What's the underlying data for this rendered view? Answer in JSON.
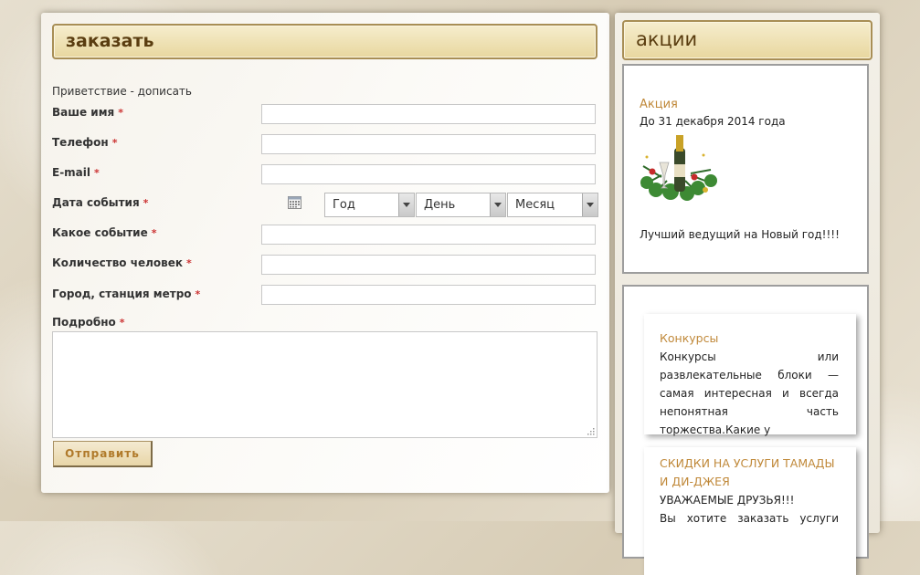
{
  "order_panel": {
    "title": "заказать",
    "greeting": "Приветствие - дописать",
    "required_mark": "*",
    "fields": {
      "name_label": "Ваше имя",
      "phone_label": "Телефон",
      "email_label": "E-mail",
      "date_label": "Дата события",
      "event_label": "Какое событие",
      "guests_label": "Количество человек",
      "city_label": "Город, станция метро",
      "details_label": "Подробно"
    },
    "date_selects": {
      "year": "Год",
      "day": "День",
      "month": "Месяц"
    },
    "submit_label": "Отправить"
  },
  "promo_panel": {
    "title": "акции",
    "promo": {
      "link": "Акция",
      "date": "До 31 декабря 2014 года",
      "text": "Лучший ведущий на Новый год!!!!",
      "image_icon": "champagne-christmas-icon"
    },
    "cards": [
      {
        "title": "Конкурсы",
        "body": "Конкурсы или развлекательные блоки — самая интересная и всегда непонятная часть торжества.Какие у"
      },
      {
        "title": "СКИДКИ НА УСЛУГИ ТАМАДЫ И ДИ-ДЖЕЯ",
        "body": "УВАЖАЕМЫЕ ДРУЗЬЯ!!!",
        "body2": "Вы хотите заказать услуги"
      }
    ]
  },
  "colors": {
    "accent_title": "#5a3d10",
    "link": "#c0893a",
    "required": "#cc3333"
  }
}
